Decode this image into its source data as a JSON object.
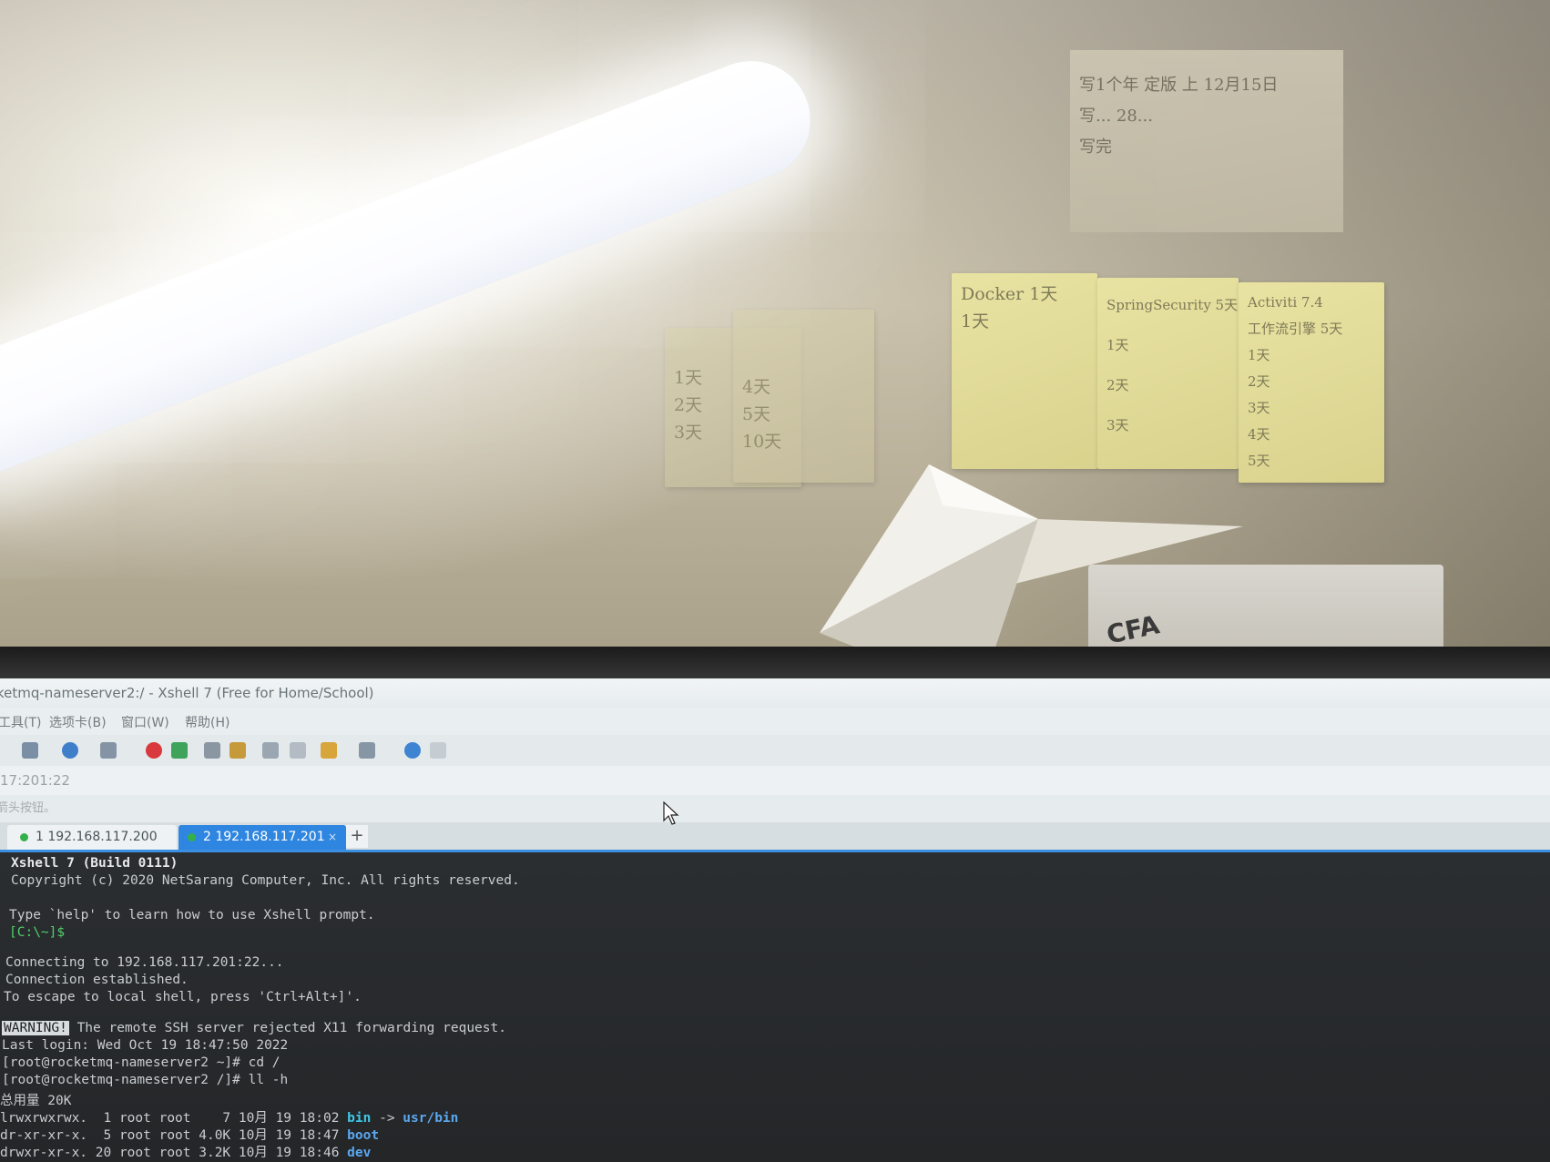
{
  "wall": {
    "top_note_lines": [
      "写1个年 定版 上 12月15日",
      "写... 28...",
      "写完 "
    ],
    "note_docker": [
      "Docker 1天",
      "1天"
    ],
    "note_spring": [
      "SpringSecurity 5天",
      "1天",
      "2天",
      "3天"
    ],
    "note_activiti": [
      "Activiti 7.4",
      "工作流引擎 5天",
      "1天",
      "2天",
      "3天",
      "4天",
      "5天"
    ],
    "note_faint_a": [
      "1天",
      "2天",
      "3天"
    ],
    "note_faint_b": [
      "4天",
      "5天",
      "10天"
    ],
    "sticker_text": "CFA"
  },
  "window": {
    "title": "ketmq-nameserver2:/ - Xshell 7 (Free for Home/School)",
    "menu": [
      "工具(T)",
      "选项卡(B)",
      "窗口(W)",
      "帮助(H)"
    ],
    "address": "17:201:22",
    "hint": "箭头按钮。",
    "tabs": [
      {
        "label": "1 192.168.117.200",
        "active": false
      },
      {
        "label": "2 192.168.117.201",
        "active": true
      }
    ],
    "tab_add": "+",
    "tab_close": "×"
  },
  "terminal": {
    "l1": "Xshell 7 (Build 0111)",
    "l2": "Copyright (c) 2020 NetSarang Computer, Inc. All rights reserved.",
    "l3": "Type `help' to learn how to use Xshell prompt.",
    "l4": "[C:\\~]$",
    "l5": "Connecting to 192.168.117.201:22...",
    "l6": "Connection established.",
    "l7": "To escape to local shell, press 'Ctrl+Alt+]'.",
    "warn_tag": "WARNING!",
    "l8": " The remote SSH server rejected X11 forwarding request.",
    "l9": "Last login: Wed Oct 19 18:47:50 2022",
    "l10": "[root@rocketmq-nameserver2 ~]# cd /",
    "l11": "[root@rocketmq-nameserver2 /]# ll -h",
    "l12": "总用量 20K",
    "r1_pre": "lrwxrwxrwx.  1 root root    7 10月 19 18:02 ",
    "r1_name": "bin",
    "r1_arrow": " -> ",
    "r1_target": "usr/bin",
    "r2_pre": "dr-xr-xr-x.  5 root root 4.0K 10月 19 18:47 ",
    "r2_name": "boot",
    "r3_pre": "drwxr-xr-x. 20 root root 3.2K 10月 19 18:46 ",
    "r3_name": "dev"
  },
  "colors": {
    "tab_active": "#2f86e0",
    "prompt_green": "#4fd16a",
    "symlink_cyan": "#3fc8e8",
    "dir_blue": "#5aa8f0"
  }
}
